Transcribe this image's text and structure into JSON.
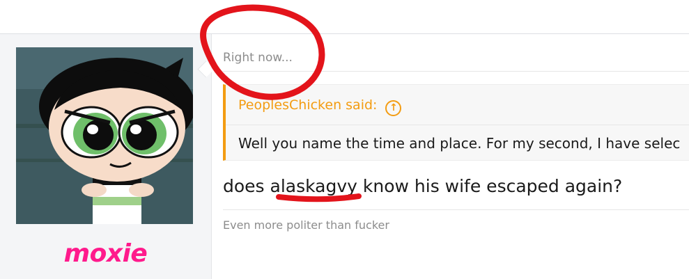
{
  "user": {
    "username": "moxie",
    "username_color": "#ff1a8c"
  },
  "post": {
    "date": "Right now...",
    "quote": {
      "author_line": "PeoplesChicken said:",
      "up_icon": "arrow-up-circle-icon",
      "body": "Well you name the time and place. For my second, I have selec"
    },
    "message": "does alaskagvy know his wife escaped again?",
    "signature": "Even more politer than fucker"
  },
  "colors": {
    "quote_accent": "#f39c12",
    "annotation_red": "#e3141b"
  }
}
